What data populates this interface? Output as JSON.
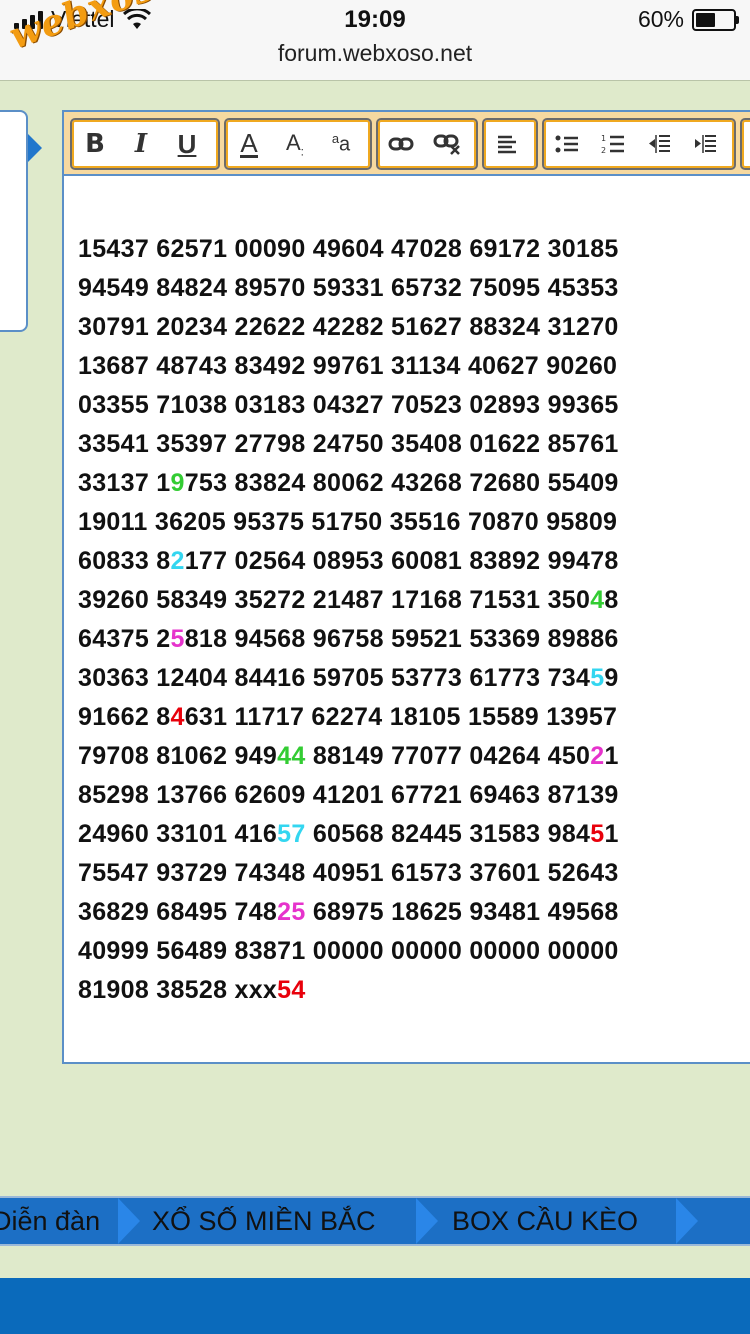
{
  "status": {
    "carrier": "Viettel",
    "time": "19:09",
    "battery": "60%",
    "battery_level": 0.6,
    "url": "forum.webxoso.net"
  },
  "watermark": "webxoso.net",
  "colors": {
    "green": "#33cc33",
    "cyan": "#33d6f0",
    "magenta": "#e633cc",
    "red": "#e8000b",
    "toolbar_bg": "#f6d9a0",
    "nav_bg": "#1c6fc5",
    "page_bg": "#dfeacb"
  },
  "toolbar": {
    "groups": [
      {
        "buttons": [
          {
            "name": "bold-button",
            "label": "B",
            "icon": "bold-icon"
          },
          {
            "name": "italic-button",
            "label": "I",
            "icon": "italic-icon"
          },
          {
            "name": "underline-button",
            "label": "U",
            "icon": "underline-icon"
          }
        ]
      },
      {
        "buttons": [
          {
            "name": "text-color-button",
            "label": "A",
            "icon": "text-color-icon"
          },
          {
            "name": "font-size-button",
            "label": "A:",
            "icon": "font-size-icon"
          },
          {
            "name": "font-family-button",
            "label": "aa",
            "icon": "font-family-icon"
          }
        ]
      },
      {
        "buttons": [
          {
            "name": "link-button",
            "label": "",
            "icon": "link-icon"
          },
          {
            "name": "unlink-button",
            "label": "",
            "icon": "unlink-icon"
          }
        ]
      },
      {
        "buttons": [
          {
            "name": "align-button",
            "label": "",
            "icon": "align-left-icon"
          }
        ]
      },
      {
        "buttons": [
          {
            "name": "bullet-list-button",
            "label": "",
            "icon": "bullet-list-icon"
          },
          {
            "name": "numbered-list-button",
            "label": "",
            "icon": "numbered-list-icon"
          },
          {
            "name": "outdent-button",
            "label": "",
            "icon": "outdent-icon"
          },
          {
            "name": "indent-button",
            "label": "",
            "icon": "indent-icon"
          }
        ]
      }
    ]
  },
  "content": {
    "lines": [
      [
        {
          "t": "15437 62571 00090 49604 47028 69172 30185"
        }
      ],
      [
        {
          "t": "94549 84824 89570 59331 65732 75095 45353"
        }
      ],
      [
        {
          "t": "30791 20234 22622 42282 51627 88324 31270"
        }
      ],
      [
        {
          "t": "13687 48743 83492 99761 31134 40627 90260"
        }
      ],
      [
        {
          "t": "03355 71038 03183 04327 70523 02893 99365"
        }
      ],
      [
        {
          "t": "33541 35397 27798 24750 35408 01622 85761"
        }
      ],
      [
        {
          "t": "33137 1"
        },
        {
          "t": "9",
          "c": "green"
        },
        {
          "t": "753 83824 80062 43268 72680 55409"
        }
      ],
      [
        {
          "t": "19011 36205 95375 51750 35516 70870 95809"
        }
      ],
      [
        {
          "t": "60833 8"
        },
        {
          "t": "2",
          "c": "cyan"
        },
        {
          "t": "177 02564 08953 60081 83892 99478"
        }
      ],
      [
        {
          "t": "39260 58349 35272 21487 17168 71531 350"
        },
        {
          "t": "4",
          "c": "green"
        },
        {
          "t": "8"
        }
      ],
      [
        {
          "t": "64375 2"
        },
        {
          "t": "5",
          "c": "magenta"
        },
        {
          "t": "818 94568 96758 59521 53369 89886"
        }
      ],
      [
        {
          "t": "30363 12404 84416 59705 53773 61773 734"
        },
        {
          "t": "5",
          "c": "cyan"
        },
        {
          "t": "9"
        }
      ],
      [
        {
          "t": "91662 8"
        },
        {
          "t": "4",
          "c": "red"
        },
        {
          "t": "631 11717 62274 18105 15589 13957"
        }
      ],
      [
        {
          "t": "79708 81062 949"
        },
        {
          "t": "44",
          "c": "green"
        },
        {
          "t": " 88149 77077 04264 450"
        },
        {
          "t": "2",
          "c": "magenta"
        },
        {
          "t": "1"
        }
      ],
      [
        {
          "t": "85298 13766 62609 41201 67721 69463 87139"
        }
      ],
      [
        {
          "t": "24960 33101 416"
        },
        {
          "t": "57",
          "c": "cyan"
        },
        {
          "t": " 60568 82445 31583 984"
        },
        {
          "t": "5",
          "c": "red"
        },
        {
          "t": "1"
        }
      ],
      [
        {
          "t": "75547 93729 74348 40951 61573 37601 52643"
        }
      ],
      [
        {
          "t": "36829 68495 748"
        },
        {
          "t": "25",
          "c": "magenta"
        },
        {
          "t": " 68975 18625 93481 49568"
        }
      ],
      [
        {
          "t": "40999 56489 83871 00000 00000 00000 00000"
        }
      ],
      [
        {
          "t": "81908 38528 xxx"
        },
        {
          "t": "54",
          "c": "red"
        }
      ]
    ]
  },
  "nav": {
    "items": [
      "Diễn đàn",
      "XỔ SỐ MIỀN BẮC",
      "BOX CẦU KÈO"
    ]
  }
}
